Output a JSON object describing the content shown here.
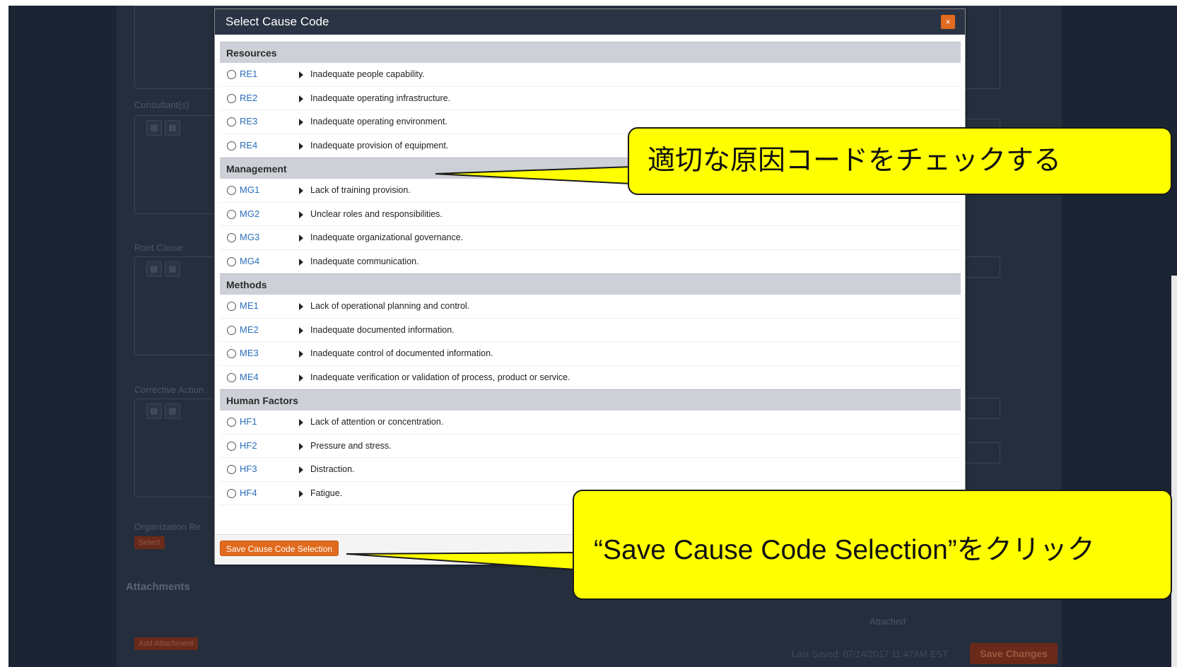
{
  "modal": {
    "title": "Select Cause Code",
    "close_label": "×",
    "sections": [
      {
        "header": "Resources",
        "items": [
          {
            "code": "RE1",
            "description": "Inadequate people capability."
          },
          {
            "code": "RE2",
            "description": "Inadequate operating infrastructure."
          },
          {
            "code": "RE3",
            "description": "Inadequate operating environment."
          },
          {
            "code": "RE4",
            "description": "Inadequate provision of equipment."
          }
        ]
      },
      {
        "header": "Management",
        "items": [
          {
            "code": "MG1",
            "description": "Lack of training provision."
          },
          {
            "code": "MG2",
            "description": "Unclear roles and responsibilities."
          },
          {
            "code": "MG3",
            "description": "Inadequate organizational governance."
          },
          {
            "code": "MG4",
            "description": "Inadequate communication."
          }
        ]
      },
      {
        "header": "Methods",
        "items": [
          {
            "code": "ME1",
            "description": "Lack of operational planning and control."
          },
          {
            "code": "ME2",
            "description": "Inadequate documented information."
          },
          {
            "code": "ME3",
            "description": "Inadequate control of documented information."
          },
          {
            "code": "ME4",
            "description": "Inadequate verification or validation of process, product or service."
          }
        ]
      },
      {
        "header": "Human Factors",
        "items": [
          {
            "code": "HF1",
            "description": "Lack of attention or concentration."
          },
          {
            "code": "HF2",
            "description": "Pressure and stress."
          },
          {
            "code": "HF3",
            "description": "Distraction."
          },
          {
            "code": "HF4",
            "description": "Fatigue."
          }
        ]
      }
    ],
    "save_button_label": "Save Cause Code Selection"
  },
  "background": {
    "field_labels": [
      "Consultant(s)",
      "Root Cause",
      "Corrective Action",
      "Organization Re"
    ],
    "select_button": "Select",
    "attachments_title": "Attachments",
    "attached_column": "Attached",
    "add_attachment_button": "Add Attachment",
    "last_saved": "Last Saved: 07/14/2017 11:47AM EST",
    "save_changes_button": "Save Changes"
  },
  "callouts": {
    "check_code": "適切な原因コードをチェックする",
    "click_save": "“Save Cause Code Selection”をクリック"
  },
  "colors": {
    "modal_header": "#2b3444",
    "accent_orange": "#e06b1e",
    "callout_yellow": "#ffff00",
    "code_link": "#2a6ebb"
  }
}
